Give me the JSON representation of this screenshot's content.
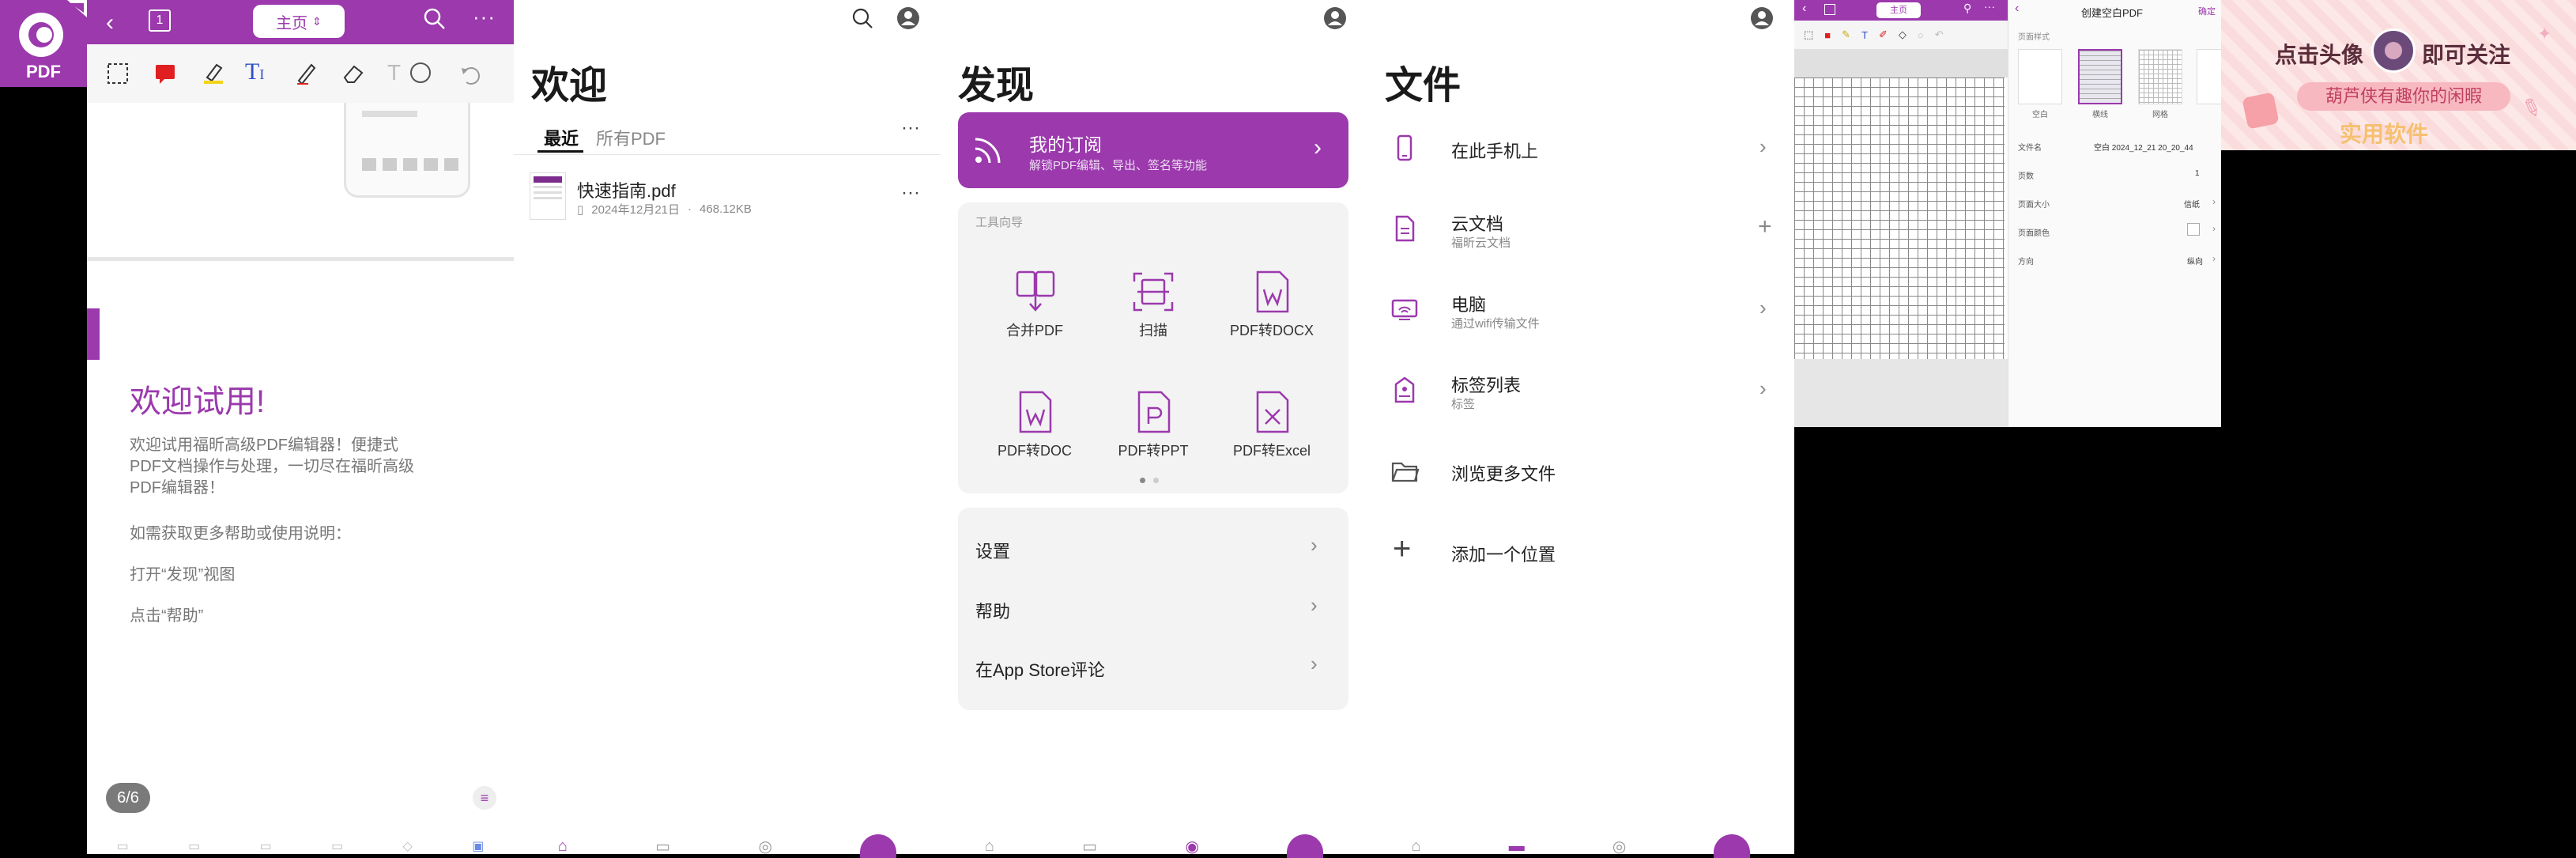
{
  "viewer": {
    "logo_text": "PDF",
    "page_box": "1",
    "home_label": "主页",
    "heading": "欢迎试用!",
    "para1": "欢迎试用福昕高级PDF编辑器！便捷式PDF文档操作与处理，一切尽在福昕高级PDF编辑器！",
    "para2": "如需获取更多帮助或使用说明：",
    "para3": "打开“发现”视图",
    "para4": "点击“帮助”",
    "page_indicator": "6/6"
  },
  "welcome": {
    "title": "欢迎",
    "tabs": [
      "最近",
      "所有PDF"
    ],
    "file_name": "快速指南.pdf",
    "file_date": "2024年12月21日",
    "file_size": "468.12KB",
    "more": "···"
  },
  "discover": {
    "title": "发现",
    "subscription_title": "我的订阅",
    "subscription_sub": "解锁PDF编辑、导出、签名等功能",
    "tools_header": "工具向导",
    "tools": [
      "合并PDF",
      "扫描",
      "PDF转DOCX",
      "PDF转DOC",
      "PDF转PPT",
      "PDF转Excel"
    ],
    "settings": [
      "设置",
      "帮助",
      "在App Store评论"
    ]
  },
  "files": {
    "title": "文件",
    "rows": [
      {
        "label": "在此手机上",
        "sub": ""
      },
      {
        "label": "云文档",
        "sub": "福昕云文档"
      },
      {
        "label": "电脑",
        "sub": "通过wifi传输文件"
      },
      {
        "label": "标签列表",
        "sub": "标签"
      },
      {
        "label": "浏览更多文件",
        "sub": ""
      },
      {
        "label": "添加一个位置",
        "sub": ""
      }
    ]
  },
  "create": {
    "home_label": "主页",
    "title": "创建空白PDF",
    "confirm": "确定",
    "page_style_label": "页面样式",
    "styles": [
      "空白",
      "横线",
      "网格"
    ],
    "fields": [
      {
        "label": "文件名",
        "value": "空白 2024_12_21 20_20_44"
      },
      {
        "label": "页数",
        "value": "1"
      },
      {
        "label": "页面大小",
        "value": "信纸"
      },
      {
        "label": "页面颜色",
        "value": ""
      },
      {
        "label": "方向",
        "value": "纵向"
      }
    ]
  },
  "banner": {
    "line1a": "点击头像",
    "line1b": "即可关注",
    "line2": "葫芦侠有趣你的闲暇",
    "line3": "实用软件"
  },
  "colors": {
    "accent": "#9b39ad",
    "card_grey": "#f3f3f3"
  }
}
